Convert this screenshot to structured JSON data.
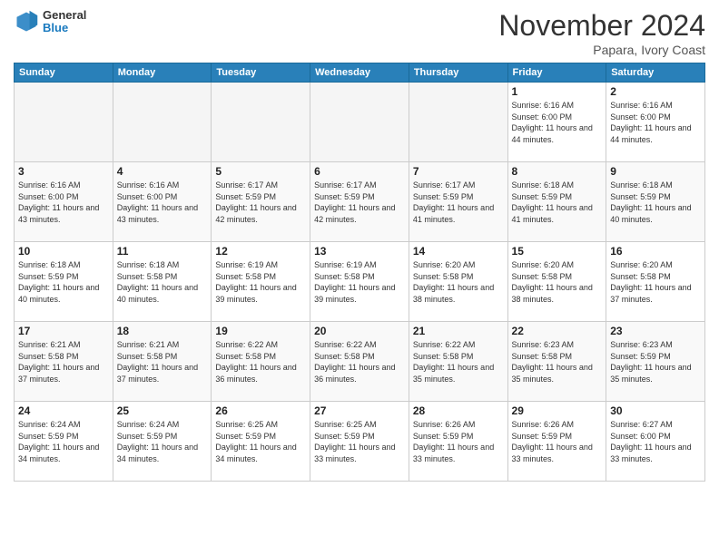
{
  "header": {
    "logo": {
      "general": "General",
      "blue": "Blue"
    },
    "title": "November 2024",
    "location": "Papara, Ivory Coast"
  },
  "days_of_week": [
    "Sunday",
    "Monday",
    "Tuesday",
    "Wednesday",
    "Thursday",
    "Friday",
    "Saturday"
  ],
  "weeks": [
    [
      {
        "day": "",
        "empty": true
      },
      {
        "day": "",
        "empty": true
      },
      {
        "day": "",
        "empty": true
      },
      {
        "day": "",
        "empty": true
      },
      {
        "day": "",
        "empty": true
      },
      {
        "day": "1",
        "sunrise": "6:16 AM",
        "sunset": "6:00 PM",
        "daylight": "11 hours and 44 minutes."
      },
      {
        "day": "2",
        "sunrise": "6:16 AM",
        "sunset": "6:00 PM",
        "daylight": "11 hours and 44 minutes."
      }
    ],
    [
      {
        "day": "3",
        "sunrise": "6:16 AM",
        "sunset": "6:00 PM",
        "daylight": "11 hours and 43 minutes."
      },
      {
        "day": "4",
        "sunrise": "6:16 AM",
        "sunset": "6:00 PM",
        "daylight": "11 hours and 43 minutes."
      },
      {
        "day": "5",
        "sunrise": "6:17 AM",
        "sunset": "5:59 PM",
        "daylight": "11 hours and 42 minutes."
      },
      {
        "day": "6",
        "sunrise": "6:17 AM",
        "sunset": "5:59 PM",
        "daylight": "11 hours and 42 minutes."
      },
      {
        "day": "7",
        "sunrise": "6:17 AM",
        "sunset": "5:59 PM",
        "daylight": "11 hours and 41 minutes."
      },
      {
        "day": "8",
        "sunrise": "6:18 AM",
        "sunset": "5:59 PM",
        "daylight": "11 hours and 41 minutes."
      },
      {
        "day": "9",
        "sunrise": "6:18 AM",
        "sunset": "5:59 PM",
        "daylight": "11 hours and 40 minutes."
      }
    ],
    [
      {
        "day": "10",
        "sunrise": "6:18 AM",
        "sunset": "5:59 PM",
        "daylight": "11 hours and 40 minutes."
      },
      {
        "day": "11",
        "sunrise": "6:18 AM",
        "sunset": "5:58 PM",
        "daylight": "11 hours and 40 minutes."
      },
      {
        "day": "12",
        "sunrise": "6:19 AM",
        "sunset": "5:58 PM",
        "daylight": "11 hours and 39 minutes."
      },
      {
        "day": "13",
        "sunrise": "6:19 AM",
        "sunset": "5:58 PM",
        "daylight": "11 hours and 39 minutes."
      },
      {
        "day": "14",
        "sunrise": "6:20 AM",
        "sunset": "5:58 PM",
        "daylight": "11 hours and 38 minutes."
      },
      {
        "day": "15",
        "sunrise": "6:20 AM",
        "sunset": "5:58 PM",
        "daylight": "11 hours and 38 minutes."
      },
      {
        "day": "16",
        "sunrise": "6:20 AM",
        "sunset": "5:58 PM",
        "daylight": "11 hours and 37 minutes."
      }
    ],
    [
      {
        "day": "17",
        "sunrise": "6:21 AM",
        "sunset": "5:58 PM",
        "daylight": "11 hours and 37 minutes."
      },
      {
        "day": "18",
        "sunrise": "6:21 AM",
        "sunset": "5:58 PM",
        "daylight": "11 hours and 37 minutes."
      },
      {
        "day": "19",
        "sunrise": "6:22 AM",
        "sunset": "5:58 PM",
        "daylight": "11 hours and 36 minutes."
      },
      {
        "day": "20",
        "sunrise": "6:22 AM",
        "sunset": "5:58 PM",
        "daylight": "11 hours and 36 minutes."
      },
      {
        "day": "21",
        "sunrise": "6:22 AM",
        "sunset": "5:58 PM",
        "daylight": "11 hours and 35 minutes."
      },
      {
        "day": "22",
        "sunrise": "6:23 AM",
        "sunset": "5:58 PM",
        "daylight": "11 hours and 35 minutes."
      },
      {
        "day": "23",
        "sunrise": "6:23 AM",
        "sunset": "5:59 PM",
        "daylight": "11 hours and 35 minutes."
      }
    ],
    [
      {
        "day": "24",
        "sunrise": "6:24 AM",
        "sunset": "5:59 PM",
        "daylight": "11 hours and 34 minutes."
      },
      {
        "day": "25",
        "sunrise": "6:24 AM",
        "sunset": "5:59 PM",
        "daylight": "11 hours and 34 minutes."
      },
      {
        "day": "26",
        "sunrise": "6:25 AM",
        "sunset": "5:59 PM",
        "daylight": "11 hours and 34 minutes."
      },
      {
        "day": "27",
        "sunrise": "6:25 AM",
        "sunset": "5:59 PM",
        "daylight": "11 hours and 33 minutes."
      },
      {
        "day": "28",
        "sunrise": "6:26 AM",
        "sunset": "5:59 PM",
        "daylight": "11 hours and 33 minutes."
      },
      {
        "day": "29",
        "sunrise": "6:26 AM",
        "sunset": "5:59 PM",
        "daylight": "11 hours and 33 minutes."
      },
      {
        "day": "30",
        "sunrise": "6:27 AM",
        "sunset": "6:00 PM",
        "daylight": "11 hours and 33 minutes."
      }
    ]
  ]
}
